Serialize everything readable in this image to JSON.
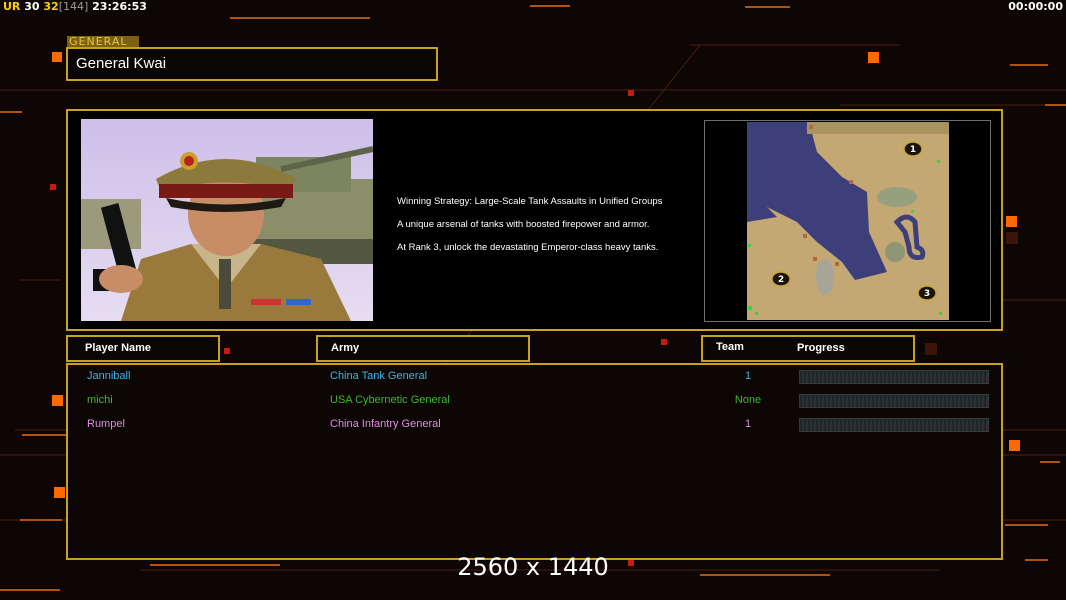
{
  "hud": {
    "ur_label": "UR",
    "value_a": "30",
    "value_b": "32",
    "value_c": "[144]",
    "clock": "23:26:53",
    "game_timer": "00:00:00"
  },
  "general": {
    "section_label": "GENERAL",
    "name": "General Kwai",
    "strategy_lines": [
      "Winning Strategy: Large-Scale Tank Assaults in Unified Groups",
      "A unique arsenal of tanks with boosted firepower and armor.",
      "At Rank 3, unlock the devastating Emperor-class heavy tanks."
    ]
  },
  "minimap": {
    "start_markers": [
      "1",
      "2",
      "3"
    ]
  },
  "table": {
    "headers": {
      "player_name": "Player Name",
      "army": "Army",
      "team": "Team",
      "progress": "Progress"
    },
    "rows": [
      {
        "name": "Janniball",
        "army": "China Tank General",
        "team": "1",
        "progress": 0,
        "color": "#3fb5e6"
      },
      {
        "name": "michi",
        "army": "USA Cybernetic General",
        "team": "None",
        "progress": 0,
        "color": "#3dbb2c"
      },
      {
        "name": "Rumpel",
        "army": "China Infantry General",
        "team": "1",
        "progress": 0,
        "color": "#e08ee6"
      }
    ]
  },
  "overlay": {
    "resolution": "2560 x 1440"
  },
  "colors": {
    "frame_gold": "#c9a21c",
    "accent_orange": "#ff6a00",
    "background": "#0d0604"
  }
}
